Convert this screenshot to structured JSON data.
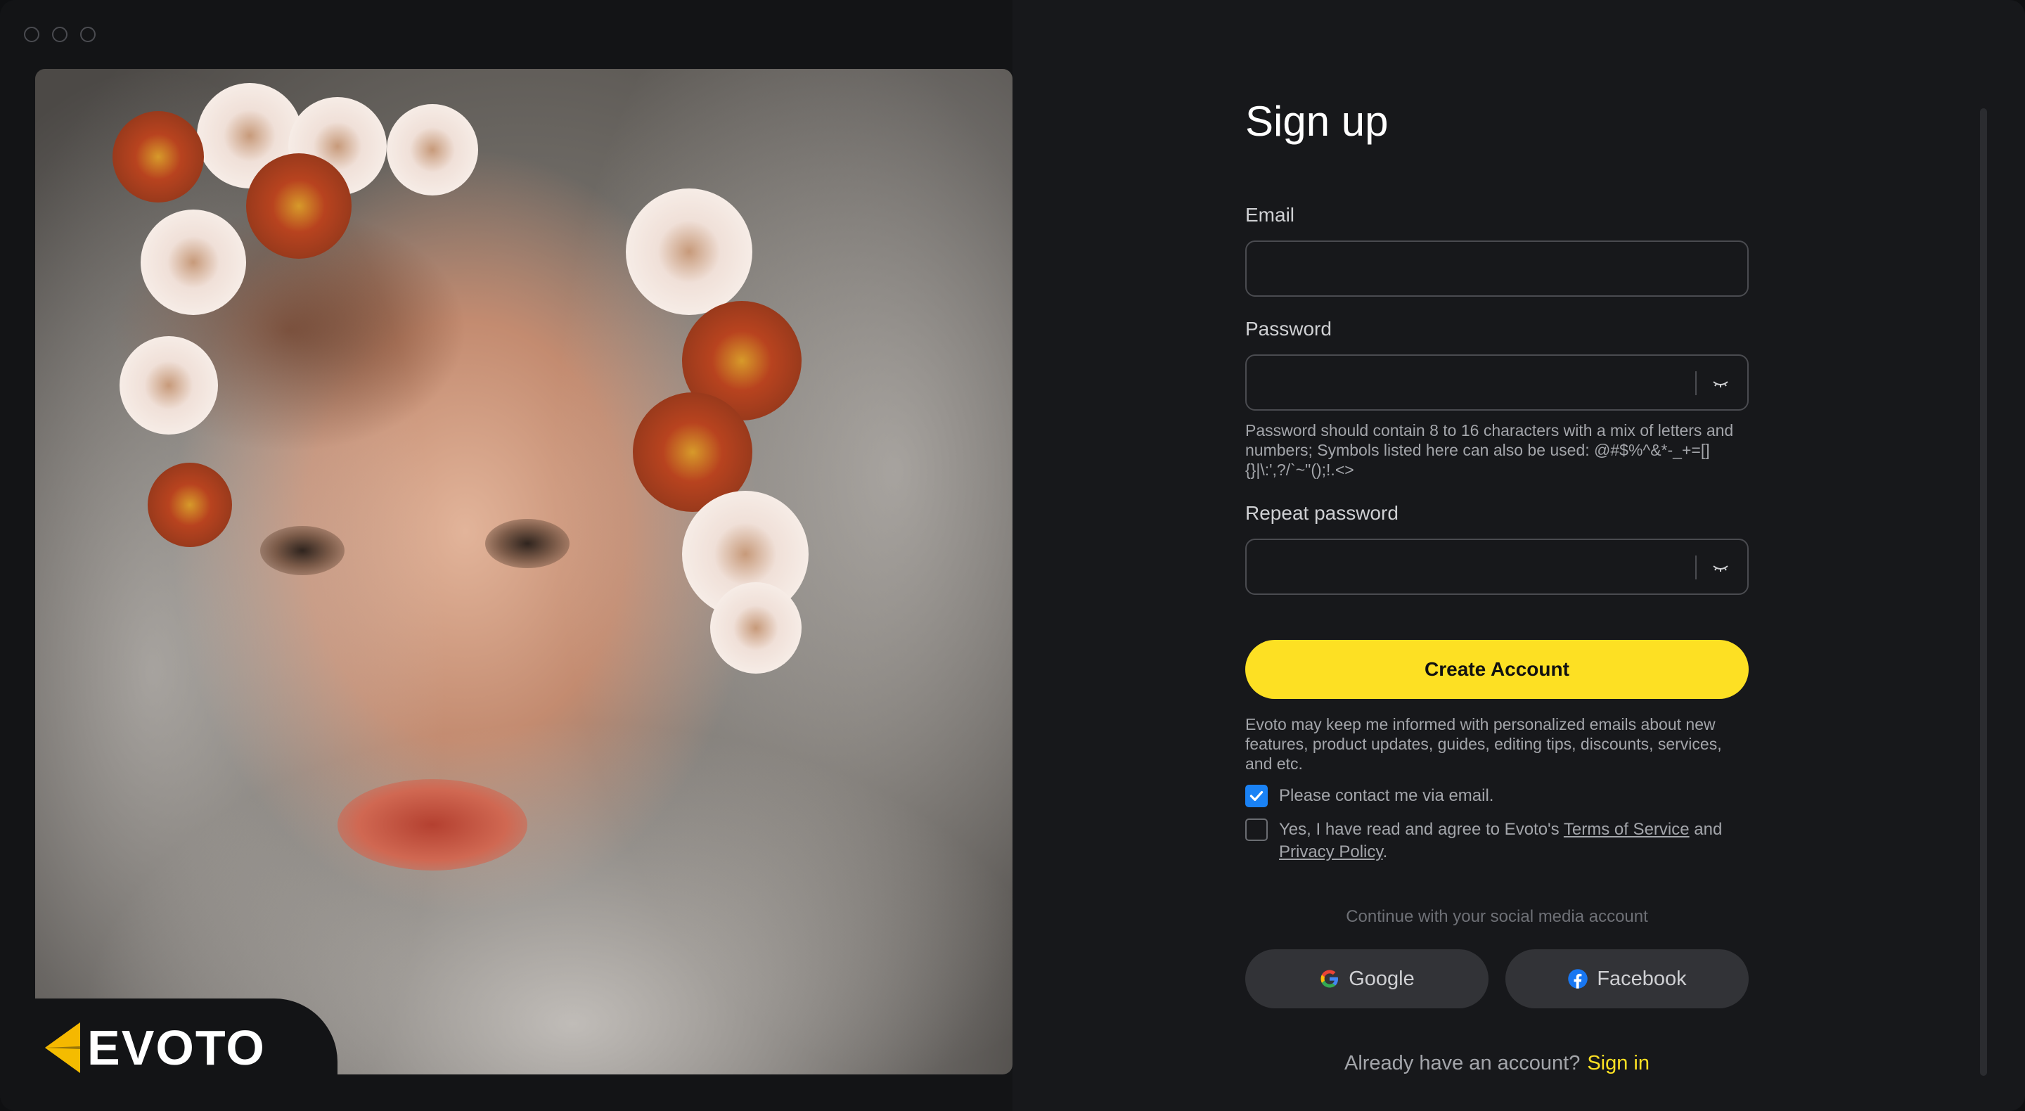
{
  "brand": {
    "name": "EVOTO",
    "accent": "#fde023",
    "mark_color": "#f5b800"
  },
  "form": {
    "title": "Sign up",
    "email_label": "Email",
    "email_value": "",
    "password_label": "Password",
    "password_value": "",
    "password_hint": "Password should contain 8 to 16 characters with a mix of letters and numbers; Symbols listed here can also be used: @#$%^&*-_+=[]{}|\\:',?/`~\"();!.<>",
    "repeat_password_label": "Repeat password",
    "repeat_password_value": "",
    "create_button": "Create Account",
    "consent_text": "Evoto may keep me informed with personalized emails about new features, product updates, guides, editing tips, discounts, services, and etc.",
    "contact_checkbox": {
      "label": "Please contact me via email.",
      "checked": true
    },
    "terms_checkbox": {
      "checked": false,
      "prefix": "Yes, I have read and agree to Evoto's ",
      "terms_link": "Terms of Service",
      "middle": " and",
      "privacy_link": "Privacy Policy",
      "suffix": "."
    },
    "social_caption": "Continue with your social media account",
    "google_button": "Google",
    "facebook_button": "Facebook",
    "signin_prompt": "Already have an account?",
    "signin_link": "Sign in"
  },
  "icons": {
    "password_toggle": "eye-closed-icon",
    "google": "google-icon",
    "facebook": "facebook-icon"
  },
  "colors": {
    "checkbox_on": "#1a82f5",
    "button_primary": "#fde023",
    "social_button": "#323337"
  }
}
